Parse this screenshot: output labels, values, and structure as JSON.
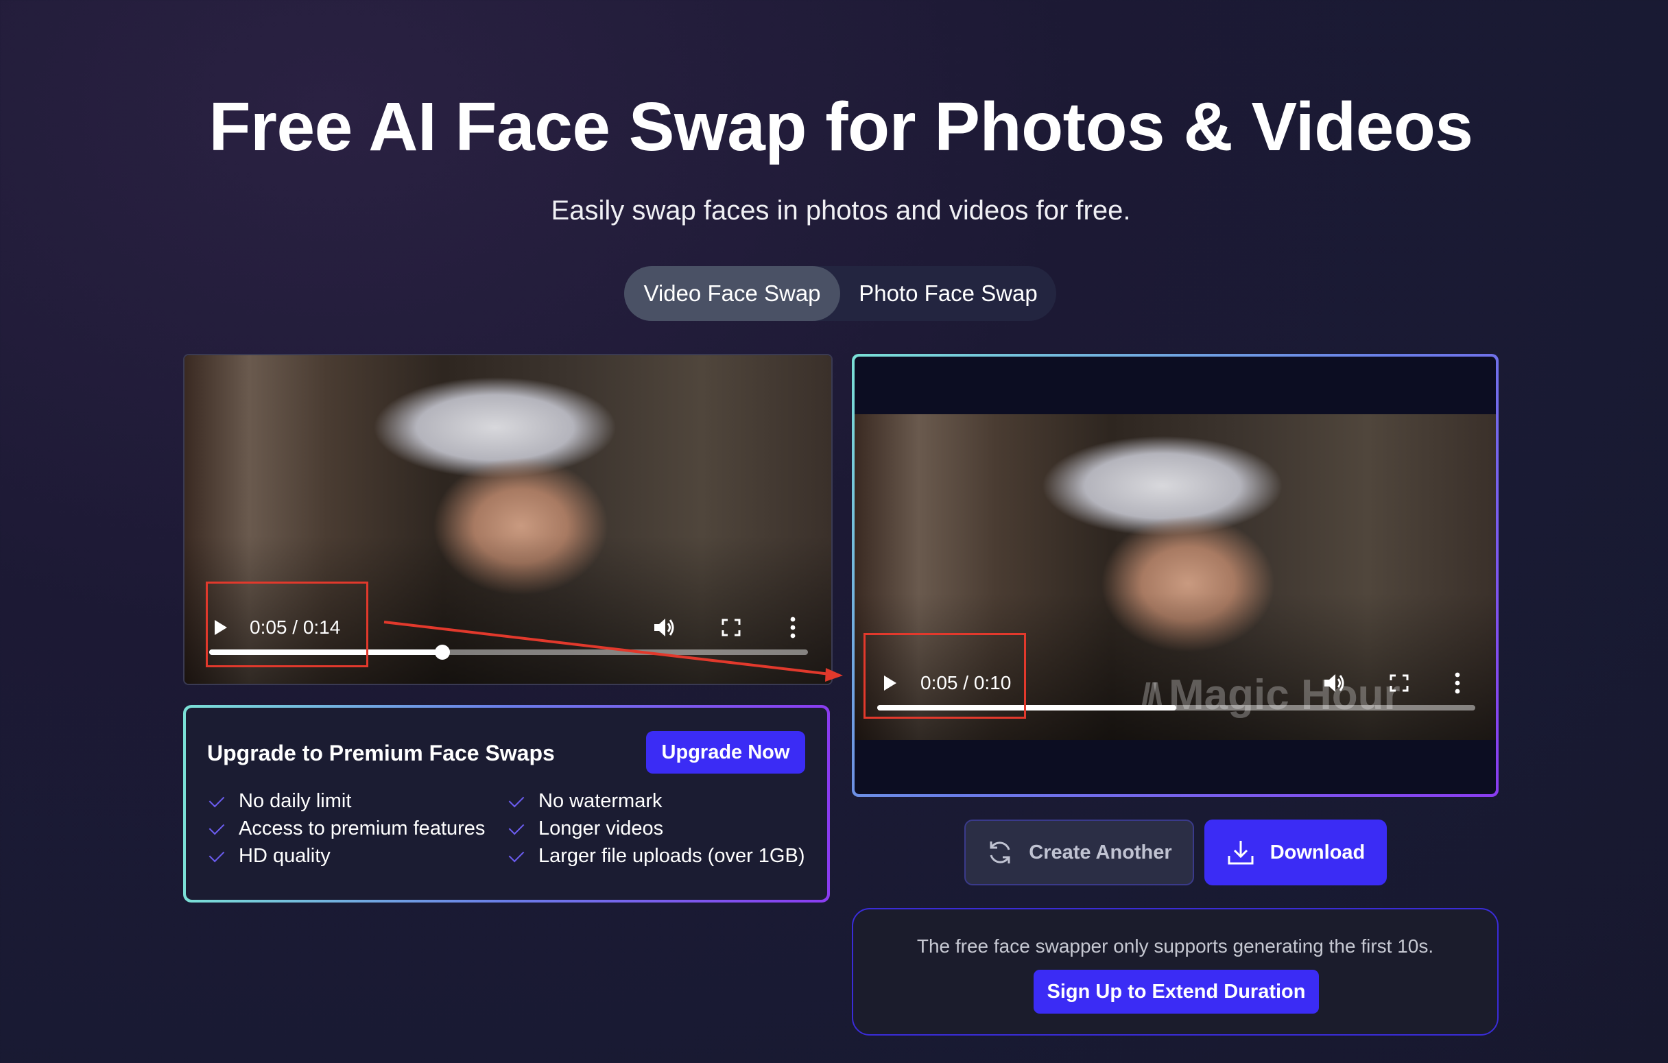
{
  "hero": {
    "title": "Free AI Face Swap for Photos & Videos",
    "subtitle": "Easily swap faces in photos and videos for free."
  },
  "tabs": [
    {
      "label": "Video Face Swap",
      "active": true
    },
    {
      "label": "Photo Face Swap",
      "active": false
    }
  ],
  "source_video": {
    "time": "0:05 / 0:14",
    "progress": 0.39,
    "icons": [
      "play-icon",
      "volume-icon",
      "fullscreen-icon",
      "more-icon"
    ]
  },
  "result_video": {
    "time": "0:05 / 0:10",
    "progress": 0.5,
    "watermark": "Magic Hour",
    "icons": [
      "play-icon",
      "volume-icon",
      "fullscreen-icon",
      "more-icon"
    ]
  },
  "upgrade": {
    "title": "Upgrade to Premium Face Swaps",
    "button_label": "Upgrade Now",
    "features_left": [
      "No daily limit",
      "Access to premium features",
      "HD quality"
    ],
    "features_right": [
      "No watermark",
      "Longer videos",
      "Larger file uploads (over 1GB)"
    ]
  },
  "actions": {
    "create_another_label": "Create Another",
    "download_label": "Download"
  },
  "notice": {
    "text": "The free face swapper only supports generating the first 10s.",
    "signup_label": "Sign Up to Extend Duration"
  },
  "colors": {
    "accent": "#3b2cf5",
    "annotation": "#e2392c",
    "background": "#1c1934"
  }
}
